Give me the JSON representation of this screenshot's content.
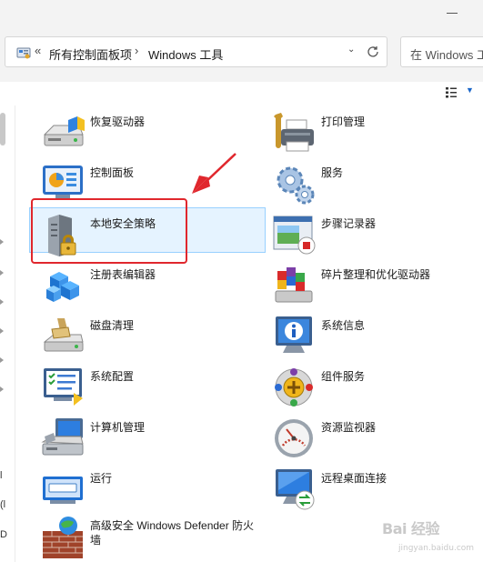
{
  "address_bar": {
    "chevrons": "«",
    "segment_1": "所有控制面板项",
    "separator": "›",
    "segment_2": "Windows 工具"
  },
  "search": {
    "placeholder": "在 Windows 工具"
  },
  "edge_labels": [
    "l",
    "(l",
    "D"
  ],
  "items": [
    {
      "name": "recovery-drive",
      "label": "恢复驱动器",
      "icon": "drive-icon"
    },
    {
      "name": "print-management",
      "label": "打印管理",
      "icon": "printer-icon"
    },
    {
      "name": "control-panel",
      "label": "控制面板",
      "icon": "control-panel-icon"
    },
    {
      "name": "services",
      "label": "服务",
      "icon": "gears-icon"
    },
    {
      "name": "local-security-policy",
      "label": "本地安全策略",
      "icon": "server-lock-icon"
    },
    {
      "name": "steps-recorder",
      "label": "步骤记录器",
      "icon": "recorder-icon"
    },
    {
      "name": "registry-editor",
      "label": "注册表编辑器",
      "icon": "cubes-icon"
    },
    {
      "name": "defragment",
      "label": "碎片整理和优化驱动器",
      "icon": "defrag-icon"
    },
    {
      "name": "disk-cleanup",
      "label": "磁盘清理",
      "icon": "disk-cleanup-icon"
    },
    {
      "name": "system-information",
      "label": "系统信息",
      "icon": "info-monitor-icon"
    },
    {
      "name": "system-configuration",
      "label": "系统配置",
      "icon": "config-monitor-icon"
    },
    {
      "name": "component-services",
      "label": "组件服务",
      "icon": "component-icon"
    },
    {
      "name": "computer-management",
      "label": "计算机管理",
      "icon": "computer-mgmt-icon"
    },
    {
      "name": "resource-monitor",
      "label": "资源监视器",
      "icon": "gauge-icon"
    },
    {
      "name": "run",
      "label": "运行",
      "icon": "run-icon"
    },
    {
      "name": "remote-desktop",
      "label": "远程桌面连接",
      "icon": "remote-desktop-icon"
    },
    {
      "name": "defender-firewall",
      "label": "高级安全 Windows Defender 防火墙",
      "icon": "firewall-icon"
    }
  ],
  "watermark": {
    "brand": "Bai 经验",
    "url": "jingyan.baidu.com"
  },
  "colors": {
    "selection_fill": "#e5f3ff",
    "selection_border": "#99d1ff",
    "annotation_red": "#e0272d"
  }
}
